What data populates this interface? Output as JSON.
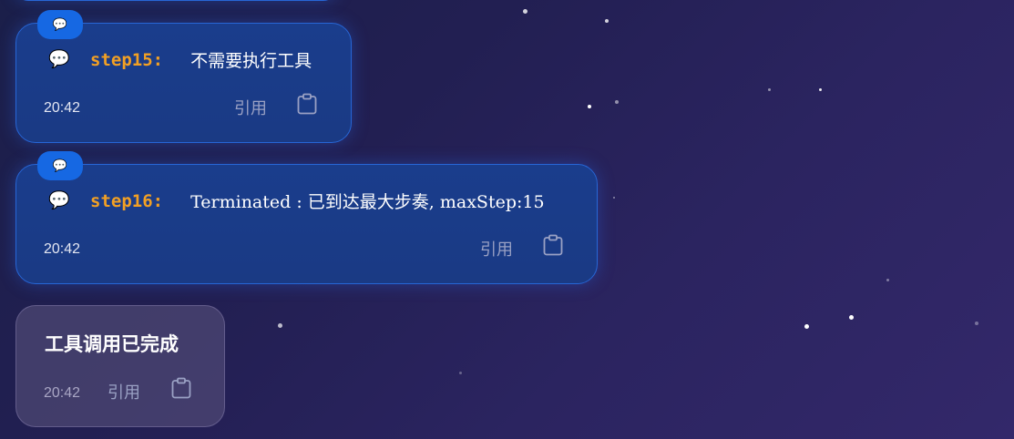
{
  "messages": [
    {
      "icon": "speech-bubble-icon",
      "step_label": "step15:",
      "text": "不需要执行工具",
      "time": "20:42",
      "quote_label": "引用"
    },
    {
      "icon": "speech-bubble-icon",
      "step_label": "step16:",
      "text": "Terminated : 已到达最大步奏, maxStep:15",
      "time": "20:42",
      "quote_label": "引用"
    }
  ],
  "status_message": {
    "text": "工具调用已完成",
    "time": "20:42",
    "quote_label": "引用"
  },
  "colors": {
    "step_label": "#f2a024",
    "tag_background": "#1668e3",
    "bubble_border": "#2766d6"
  }
}
